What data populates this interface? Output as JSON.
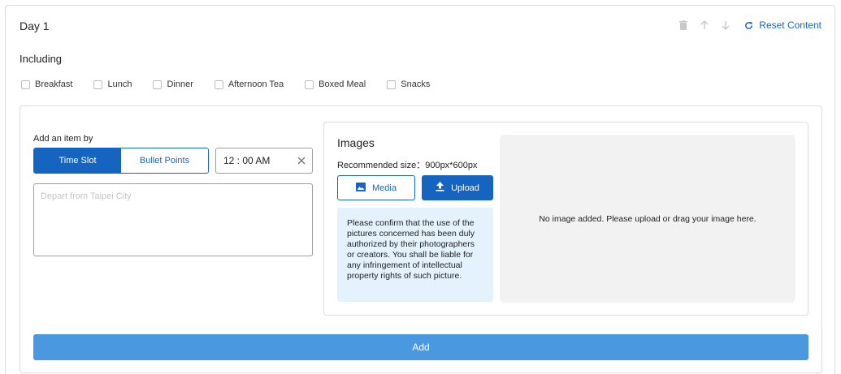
{
  "day": {
    "title": "Day 1"
  },
  "actions": {
    "icons": [
      "trash-icon",
      "arrow-up-icon",
      "arrow-down-icon",
      "refresh-icon"
    ],
    "reset_label": "Reset Content"
  },
  "including": {
    "label": "Including",
    "meals": [
      {
        "label": "Breakfast",
        "checked": false
      },
      {
        "label": "Lunch",
        "checked": false
      },
      {
        "label": "Dinner",
        "checked": false
      },
      {
        "label": "Afternoon Tea",
        "checked": false
      },
      {
        "label": "Boxed Meal",
        "checked": false
      },
      {
        "label": "Snacks",
        "checked": false
      }
    ]
  },
  "item_form": {
    "add_by_label": "Add an item by",
    "modes": [
      {
        "label": "Time Slot",
        "active": true
      },
      {
        "label": "Bullet Points",
        "active": false
      }
    ],
    "time_value": "12 : 00 AM",
    "description_placeholder": "Depart from Taipei City"
  },
  "images": {
    "title": "Images",
    "recommended_size": "Recommended size：900px*600px",
    "media_label": "Media",
    "upload_label": "Upload",
    "notice": "Please confirm that the use of the pictures concerned has been duly authorized by their photographers or creators. You shall be liable for any infringement of intellectual property rights of such picture.",
    "empty_text": "No image added. Please upload or drag your image here."
  },
  "add_label": "Add",
  "colors": {
    "primary": "#1565c0",
    "add_button": "#4a98e0",
    "notice_bg": "#e3f2fd",
    "dropzone_bg": "#f2f2f2",
    "disabled_icon": "#c8c8c8"
  }
}
